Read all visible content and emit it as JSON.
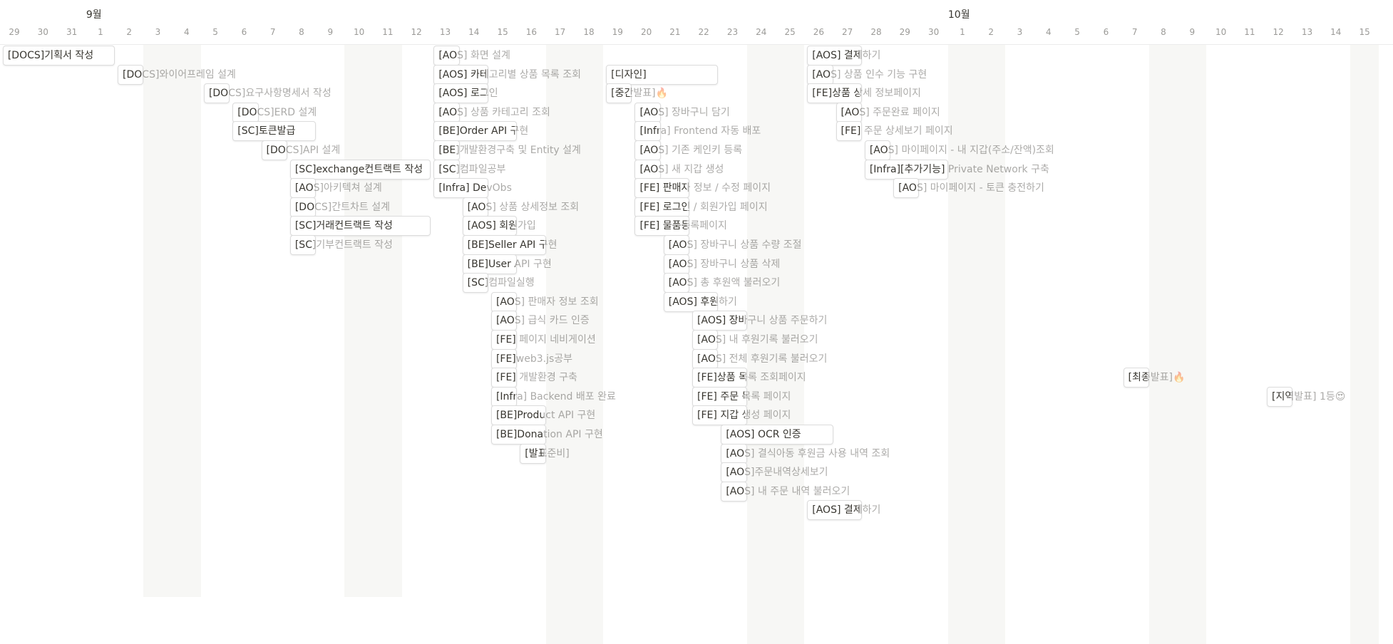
{
  "timeline": {
    "months": [
      {
        "label": "9월",
        "day_index": 3
      },
      {
        "label": "10월",
        "day_index": 33
      }
    ],
    "days": [
      "29",
      "30",
      "31",
      "1",
      "2",
      "3",
      "4",
      "5",
      "6",
      "7",
      "8",
      "9",
      "10",
      "11",
      "12",
      "13",
      "14",
      "15",
      "16",
      "17",
      "18",
      "19",
      "20",
      "21",
      "22",
      "23",
      "24",
      "25",
      "26",
      "27",
      "28",
      "29",
      "30",
      "1",
      "2",
      "3",
      "4",
      "5",
      "6",
      "7",
      "8",
      "9",
      "10",
      "11",
      "12",
      "13",
      "14",
      "15"
    ],
    "weekend_day_indexes": [
      5,
      6,
      12,
      13,
      19,
      20,
      26,
      27,
      33,
      34,
      40,
      41,
      47
    ]
  },
  "tasks": [
    {
      "label": "[DOCS]기획서 작성",
      "start": 0,
      "days": 4,
      "row": 0
    },
    {
      "label": "[DOCS]와이어프레임 설계",
      "start": 4,
      "days": 1,
      "row": 1
    },
    {
      "label": "[DOCS]요구사항명세서 작성",
      "start": 7,
      "days": 1,
      "row": 2
    },
    {
      "label": "[DOCS]ERD 설계",
      "start": 8,
      "days": 1,
      "row": 3
    },
    {
      "label": "[SC]토큰발급",
      "start": 8,
      "days": 3,
      "row": 4
    },
    {
      "label": "[DOCS]API 설계",
      "start": 9,
      "days": 1,
      "row": 5
    },
    {
      "label": "[SC]exchange컨트랙트 작성",
      "start": 10,
      "days": 5,
      "row": 6
    },
    {
      "label": "[AOS]아키텍쳐 설계",
      "start": 10,
      "days": 1,
      "row": 7
    },
    {
      "label": "[DOCS]간트차트 설계",
      "start": 10,
      "days": 1,
      "row": 8
    },
    {
      "label": "[SC]거래컨트랙트 작성",
      "start": 10,
      "days": 5,
      "row": 9
    },
    {
      "label": "[SC]기부컨트랙트 작성",
      "start": 10,
      "days": 1,
      "row": 10
    },
    {
      "label": "[AOS] 화면 설계",
      "start": 15,
      "days": 1,
      "row": 0
    },
    {
      "label": "[AOS] 카테고리별 상품 목록 조회",
      "start": 15,
      "days": 2,
      "row": 1
    },
    {
      "label": "[AOS] 로그인",
      "start": 15,
      "days": 2,
      "row": 2
    },
    {
      "label": "[AOS] 상품 카테고리 조회",
      "start": 15,
      "days": 1,
      "row": 3
    },
    {
      "label": "[BE]Order API 구현",
      "start": 15,
      "days": 3,
      "row": 4
    },
    {
      "label": "[BE]개발환경구축 및 Entity 설계",
      "start": 15,
      "days": 1,
      "row": 5
    },
    {
      "label": "[SC]컴파일공부",
      "start": 15,
      "days": 1,
      "row": 6
    },
    {
      "label": "[Infra] DevObs",
      "start": 15,
      "days": 2,
      "row": 7
    },
    {
      "label": "[AOS] 상품 상세정보 조회",
      "start": 16,
      "days": 1,
      "row": 8
    },
    {
      "label": "[AOS] 회원가입",
      "start": 16,
      "days": 2,
      "row": 9
    },
    {
      "label": "[BE]Seller API 구현",
      "start": 16,
      "days": 3,
      "row": 10
    },
    {
      "label": "[BE]User API 구현",
      "start": 16,
      "days": 2,
      "row": 11
    },
    {
      "label": "[SC]컴파일실행",
      "start": 16,
      "days": 1,
      "row": 12
    },
    {
      "label": "[AOS] 판매자 정보 조회",
      "start": 17,
      "days": 1,
      "row": 13
    },
    {
      "label": "[AOS] 급식 카드 인증",
      "start": 17,
      "days": 1,
      "row": 14
    },
    {
      "label": "[FE] 페이지 네비게이션",
      "start": 17,
      "days": 1,
      "row": 15
    },
    {
      "label": "[FE]web3.js공부",
      "start": 17,
      "days": 1,
      "row": 16
    },
    {
      "label": "[FE] 개발환경 구축",
      "start": 17,
      "days": 1,
      "row": 17
    },
    {
      "label": "[Infra] Backend 배포 완료",
      "start": 17,
      "days": 1,
      "row": 18
    },
    {
      "label": "[BE]Product API 구현",
      "start": 17,
      "days": 2,
      "row": 19
    },
    {
      "label": "[BE]Donation API 구현",
      "start": 17,
      "days": 2,
      "row": 20
    },
    {
      "label": "[발표준비]",
      "start": 18,
      "days": 1,
      "row": 21
    },
    {
      "label": "[디자인]",
      "start": 21,
      "days": 4,
      "row": 1
    },
    {
      "label": "[중간발표]🔥",
      "start": 21,
      "days": 1,
      "row": 2
    },
    {
      "label": "[AOS] 장바구니 담기",
      "start": 22,
      "days": 1,
      "row": 3
    },
    {
      "label": "[Infra] Frontend 자동 배포",
      "start": 22,
      "days": 1,
      "row": 4
    },
    {
      "label": "[AOS] 기존 케인키 등록",
      "start": 22,
      "days": 1,
      "row": 5
    },
    {
      "label": "[AOS] 새 지갑 생성",
      "start": 22,
      "days": 1,
      "row": 6
    },
    {
      "label": "[FE] 판매자 정보 / 수정 페이지",
      "start": 22,
      "days": 2,
      "row": 7
    },
    {
      "label": "[FE] 로그인 / 회원가입 페이지",
      "start": 22,
      "days": 2,
      "row": 8
    },
    {
      "label": "[FE] 물품등록페이지",
      "start": 22,
      "days": 2,
      "row": 9
    },
    {
      "label": "[AOS] 장바구니 상품 수량 조절",
      "start": 23,
      "days": 1,
      "row": 10
    },
    {
      "label": "[AOS] 장바구니 상품 삭제",
      "start": 23,
      "days": 1,
      "row": 11
    },
    {
      "label": "[AOS] 총 후원액 불러오기",
      "start": 23,
      "days": 1,
      "row": 12
    },
    {
      "label": "[AOS] 후원하기",
      "start": 23,
      "days": 2,
      "row": 13
    },
    {
      "label": "[AOS] 장바구니 상품 주문하기",
      "start": 24,
      "days": 2,
      "row": 14
    },
    {
      "label": "[AOS] 내 후원기록 불러오기",
      "start": 24,
      "days": 1,
      "row": 15
    },
    {
      "label": "[AOS] 전체 후원기록 불러오기",
      "start": 24,
      "days": 1,
      "row": 16
    },
    {
      "label": "[FE]상품 목록 조회페이지",
      "start": 24,
      "days": 2,
      "row": 17
    },
    {
      "label": "[FE] 주문 목록 페이지",
      "start": 24,
      "days": 2,
      "row": 18
    },
    {
      "label": "[FE] 지갑 생성 페이지",
      "start": 24,
      "days": 2,
      "row": 19
    },
    {
      "label": "[AOS] OCR 인증",
      "start": 25,
      "days": 4,
      "row": 20
    },
    {
      "label": "[AOS] 결식아동 후원금 사용 내역 조회",
      "start": 25,
      "days": 1,
      "row": 21
    },
    {
      "label": "[AOS]주문내역상세보기",
      "start": 25,
      "days": 1,
      "row": 22
    },
    {
      "label": "[AOS] 내 주문 내역 불러오기",
      "start": 25,
      "days": 1,
      "row": 23
    },
    {
      "label": "[AOS] 결제하기",
      "start": 28,
      "days": 2,
      "row": 24
    },
    {
      "label": "[AOS] 결제하기",
      "start": 28,
      "days": 2,
      "row": 0
    },
    {
      "label": "[AOS] 상품 인수 기능 구현",
      "start": 28,
      "days": 1,
      "row": 1
    },
    {
      "label": "[FE]상품 상세 정보페이지",
      "start": 28,
      "days": 2,
      "row": 2
    },
    {
      "label": "[AOS] 주문완료 페이지",
      "start": 29,
      "days": 1,
      "row": 3
    },
    {
      "label": "[FE] 주문 상세보기 페이지",
      "start": 29,
      "days": 1,
      "row": 4
    },
    {
      "label": "[AOS] 마이페이지 - 내 지갑(주소/잔액)조회",
      "start": 30,
      "days": 1,
      "row": 5
    },
    {
      "label": "[Infra][추가기능] Private Network 구축",
      "start": 30,
      "days": 3,
      "row": 6
    },
    {
      "label": "[AOS] 마이페이지 - 토큰 충전하기",
      "start": 31,
      "days": 1,
      "row": 7
    },
    {
      "label": "[최종발표]🔥",
      "start": 39,
      "days": 1,
      "row": 17
    },
    {
      "label": "[지역발표] 1등😍",
      "start": 44,
      "days": 1,
      "row": 18
    }
  ]
}
